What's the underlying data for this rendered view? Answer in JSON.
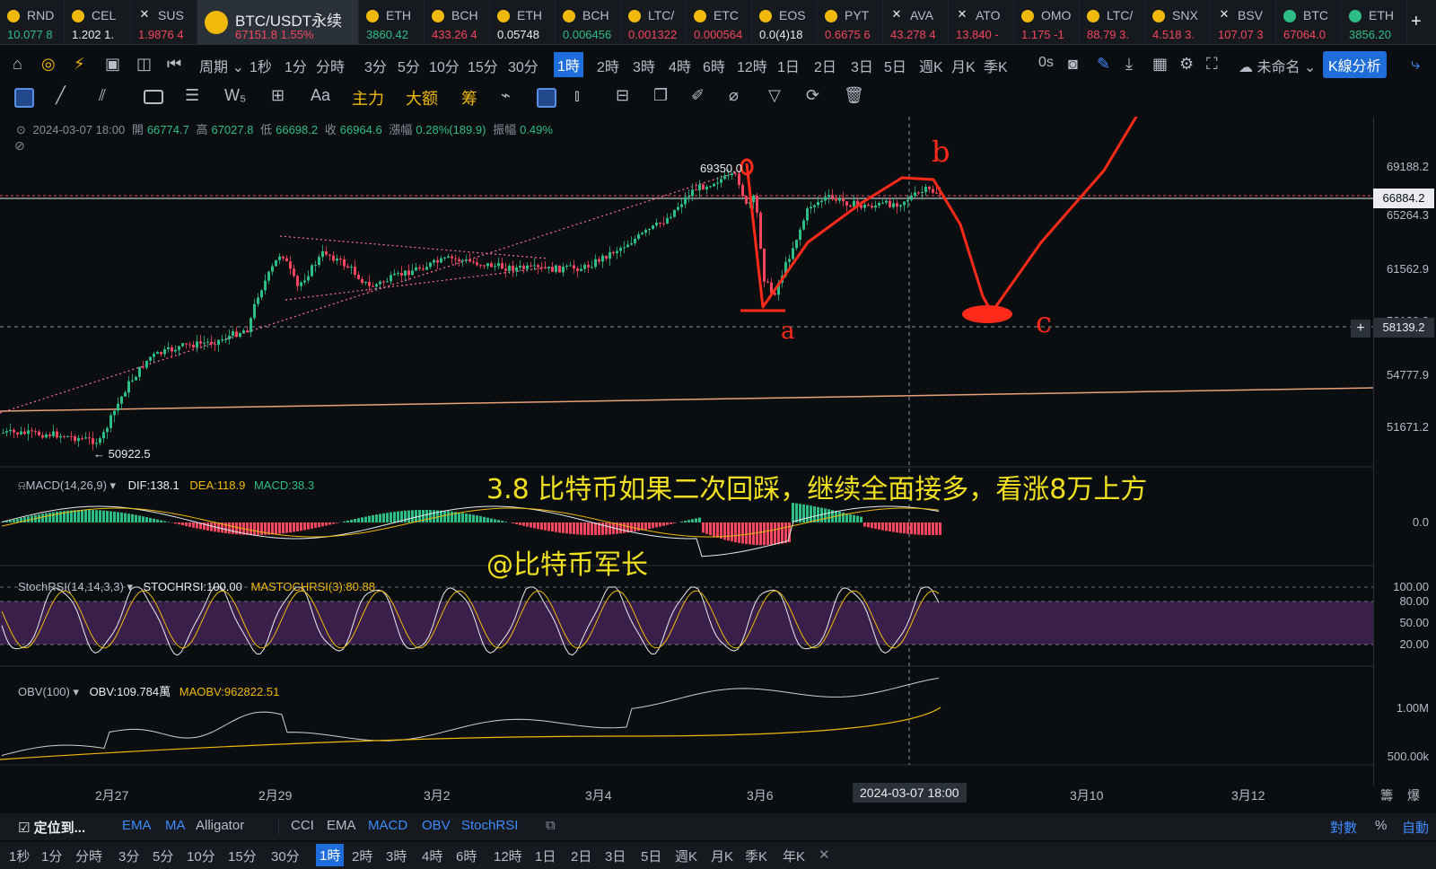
{
  "ticker": [
    {
      "sym": "RND",
      "price": "10.077 8",
      "icon": "coin-icon",
      "color": "#2ebd85"
    },
    {
      "sym": "CEL",
      "price": "1.202 1.",
      "icon": "coin-icon",
      "color": "#eaecef"
    },
    {
      "sym": "SUS",
      "price": "1.9876 4",
      "icon": "x-icon",
      "color": "#f6465d"
    },
    {
      "sym": "ETH",
      "price": "3860.42",
      "icon": "coin-icon",
      "color": "#2ebd85"
    },
    {
      "sym": "BCH",
      "price": "433.26 4",
      "icon": "coin-icon",
      "color": "#f6465d"
    },
    {
      "sym": "ETH",
      "price": "0.05748",
      "icon": "coin-icon",
      "color": "#eaecef"
    },
    {
      "sym": "BCH",
      "price": "0.006456",
      "icon": "coin-icon",
      "color": "#2ebd85"
    },
    {
      "sym": "LTC/",
      "price": "0.001322",
      "icon": "coin-icon",
      "color": "#f6465d"
    },
    {
      "sym": "ETC",
      "price": "0.000564",
      "icon": "coin-icon",
      "color": "#f6465d"
    },
    {
      "sym": "EOS",
      "price": "0.0(4)18",
      "icon": "coin-icon",
      "color": "#eaecef"
    },
    {
      "sym": "PYT",
      "price": "0.6675 6",
      "icon": "coin-icon",
      "color": "#f6465d"
    },
    {
      "sym": "AVA",
      "price": "43.278 4",
      "icon": "x-icon",
      "color": "#f6465d"
    },
    {
      "sym": "ATO",
      "price": "13.840 -",
      "icon": "x-icon",
      "color": "#f6465d"
    },
    {
      "sym": "OMO",
      "price": "1.175 -1",
      "icon": "coin-icon",
      "color": "#f6465d"
    },
    {
      "sym": "LTC/",
      "price": "88.79 3.",
      "icon": "coin-icon",
      "color": "#f6465d"
    },
    {
      "sym": "SNX",
      "price": "4.518 3.",
      "icon": "coin-icon",
      "color": "#f6465d"
    },
    {
      "sym": "BSV",
      "price": "107.07 3",
      "icon": "x-icon",
      "color": "#f6465d"
    },
    {
      "sym": "BTC",
      "price": "67064.0",
      "icon": "coin-icon",
      "color": "#f6465d"
    },
    {
      "sym": "ETH",
      "price": "3856.20",
      "icon": "coin-icon",
      "color": "#2ebd85"
    }
  ],
  "active_pair": {
    "sym": "BTC/USDT永续",
    "price": "67151.8",
    "change": "1.55%"
  },
  "toolbar": {
    "period_label": "周期",
    "timeframes": [
      "1秒",
      "1分",
      "分時",
      "3分",
      "5分",
      "10分",
      "15分",
      "30分",
      "1時",
      "2時",
      "3時",
      "4時",
      "6時",
      "12時",
      "1日",
      "2日",
      "3日",
      "5日",
      "週K",
      "月K",
      "季K"
    ],
    "selected_tf": "1時",
    "countdown": "0s",
    "layout_name": "未命名",
    "kline_btn": "K線分析"
  },
  "draw_tools": {
    "aa": "Aa",
    "main": "主力",
    "big": "大额",
    "chip": "筹"
  },
  "ohlc": {
    "datetime": "2024-03-07 18:00",
    "open_label": "開",
    "open": "66774.7",
    "high_label": "高",
    "high": "67027.8",
    "low_label": "低",
    "low": "66698.2",
    "close_label": "收",
    "close": "66964.6",
    "chg_label": "漲幅",
    "chg": "0.28%(189.9)",
    "amp_label": "振幅",
    "amp": "0.49%"
  },
  "price_axis": [
    "69188.2",
    "65264.3",
    "61562.9",
    "58139.2",
    "54777.9",
    "51671.2"
  ],
  "last_price": "66884.2",
  "crosshair_price": "58139.2",
  "high_mark": "69350.0",
  "low_mark": "50922.5",
  "annotation": {
    "main": "3.8 比特币如果二次回踩，继续全面接多，看涨8万上方",
    "author": "@比特币军长"
  },
  "hand_labels": {
    "a": "a",
    "b": "b",
    "c": "c"
  },
  "macd": {
    "name": "MACD(14,26,9)",
    "dif": "DIF:138.1",
    "dea": "DEA:118.9",
    "macd": "MACD:38.3",
    "axis": "0.0"
  },
  "stoch": {
    "name": "StochRSI(14,14,3,3)",
    "k": "STOCHRSI:100.00",
    "d": "MASTOCHRSI(3):80.88",
    "levels": [
      "100.00",
      "80.00",
      "50.00",
      "20.00"
    ]
  },
  "obv": {
    "name": "OBV(100)",
    "val": "OBV:109.784萬",
    "ma": "MAOBV:962822.51",
    "levels": [
      "1.00M",
      "500.00k"
    ]
  },
  "time_axis": [
    "2月27",
    "2月29",
    "3月2",
    "3月4",
    "3月6",
    "3月10",
    "3月12"
  ],
  "cursor_time": "2024-03-07 18:00",
  "bottom_bar": {
    "locate": "定位到...",
    "indicators": [
      "EMA",
      "MA",
      "Alligator",
      "CCI",
      "EMA",
      "MACD",
      "OBV",
      "StochRSI"
    ],
    "right": [
      "對數",
      "%",
      "自動"
    ],
    "corner": [
      "籌",
      "爆"
    ]
  },
  "bottom_tfs": [
    "1秒",
    "1分",
    "分時",
    "3分",
    "5分",
    "10分",
    "15分",
    "30分",
    "1時",
    "2時",
    "3時",
    "4時",
    "6時",
    "12時",
    "1日",
    "2日",
    "3日",
    "5日",
    "週K",
    "月K",
    "季K",
    "年K"
  ],
  "colors": {
    "up": "#2ebd85",
    "down": "#f6465d",
    "accent": "#f0b90b",
    "blue": "#1e6dda",
    "drawing": "#ff2a1a"
  }
}
